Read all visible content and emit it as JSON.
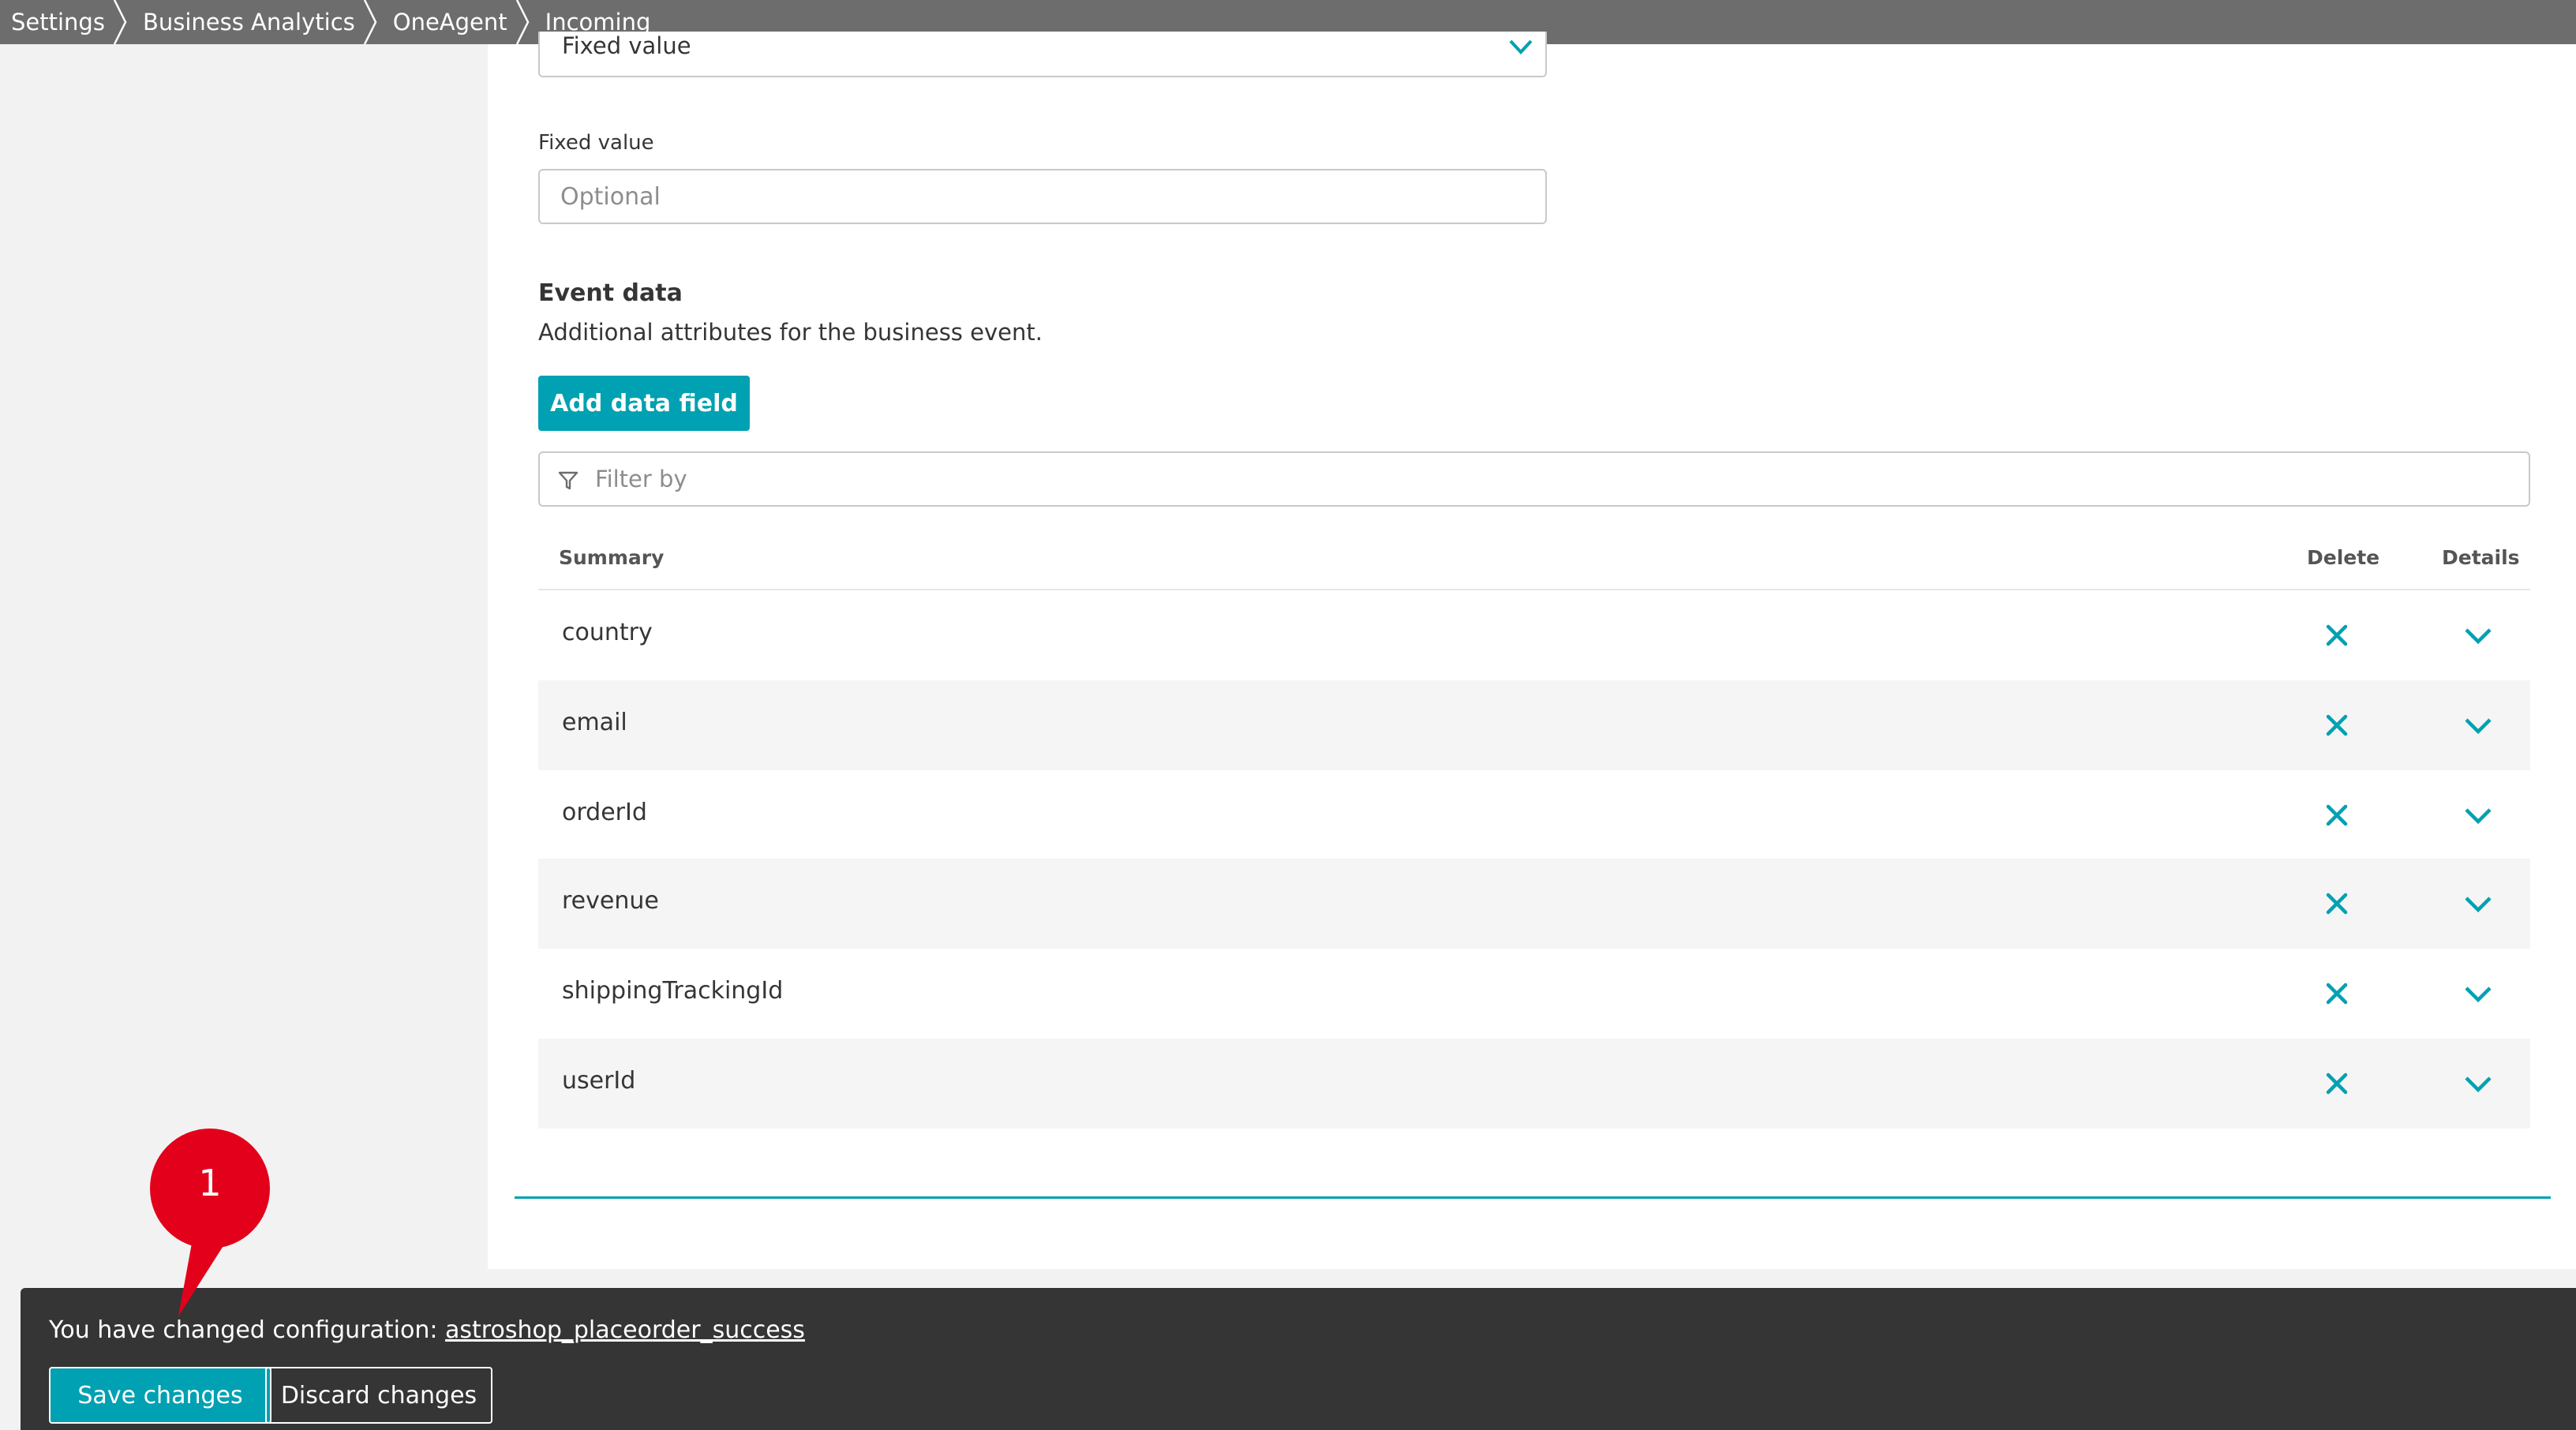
{
  "breadcrumb": [
    {
      "label": "Settings"
    },
    {
      "label": "Business Analytics"
    },
    {
      "label": "OneAgent"
    },
    {
      "label": "Incoming"
    }
  ],
  "source_select": {
    "value": "Fixed value"
  },
  "fixed_value": {
    "label": "Fixed value",
    "placeholder": "Optional"
  },
  "event_data": {
    "title": "Event data",
    "description": "Additional attributes for the business event.",
    "add_button": "Add data field",
    "filter_placeholder": "Filter by",
    "columns": {
      "summary": "Summary",
      "delete": "Delete",
      "details": "Details"
    },
    "rows": [
      {
        "name": "country"
      },
      {
        "name": "email"
      },
      {
        "name": "orderId"
      },
      {
        "name": "revenue"
      },
      {
        "name": "shippingTrackingId"
      },
      {
        "name": "userId"
      }
    ]
  },
  "toast": {
    "message": "You have changed configuration: ",
    "config_name": "astroshop_placeorder_success",
    "save": "Save changes",
    "discard": "Discard changes"
  },
  "annotation": {
    "number": "1"
  },
  "colors": {
    "accent": "#00a1b2",
    "topbar": "#6d6d6d",
    "toast": "#353535",
    "marker": "#e3001b"
  }
}
